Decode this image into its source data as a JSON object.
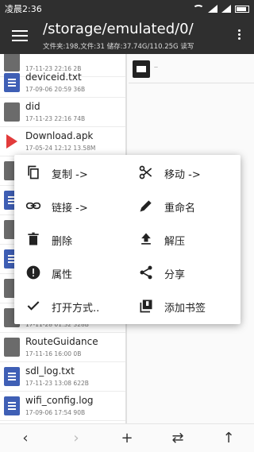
{
  "status": {
    "time": "凌晨2:36"
  },
  "appbar": {
    "path": "/storage/emulated/0/",
    "info": "文件夹:198,文件:31  储存:37.74G/110.25G  读写"
  },
  "left_files": [
    {
      "name": "",
      "meta": "17-11-23 22:16  2B",
      "icon": "gray"
    },
    {
      "name": "deviceid.txt",
      "meta": "17-09-06 20:59  36B",
      "icon": "doc"
    },
    {
      "name": "did",
      "meta": "17-11-23 22:16  74B",
      "icon": "gray"
    },
    {
      "name": "Download.apk",
      "meta": "17-05-24 12:12  13.58M",
      "icon": "apk"
    },
    {
      "name": "",
      "meta": "",
      "icon": "gray"
    },
    {
      "name": "",
      "meta": "",
      "icon": "doc"
    },
    {
      "name": "",
      "meta": "",
      "icon": "gray"
    },
    {
      "name": "",
      "meta": "",
      "icon": "doc"
    },
    {
      "name": "",
      "meta": "",
      "icon": "gray"
    },
    {
      "name": "",
      "meta": "17-11-28 01:32  328B",
      "icon": "gray"
    },
    {
      "name": "RouteGuidance",
      "meta": "17-11-16 16:00  0B",
      "icon": "gray"
    },
    {
      "name": "sdl_log.txt",
      "meta": "17-11-23 13:08  622B",
      "icon": "doc"
    },
    {
      "name": "wifi_config.log",
      "meta": "17-09-06 17:54  90B",
      "icon": "doc"
    }
  ],
  "right_pane": {
    "parent_label": ".."
  },
  "menu": {
    "copy": "复制 ->",
    "move": "移动 ->",
    "link": "链接 ->",
    "rename": "重命名",
    "delete": "删除",
    "extract": "解压",
    "properties": "属性",
    "share": "分享",
    "open_with": "打开方式..",
    "bookmark": "添加书签"
  },
  "bottom": {
    "back": "‹",
    "forward": "›",
    "add": "+",
    "swap": "⇄",
    "up": "↑"
  }
}
